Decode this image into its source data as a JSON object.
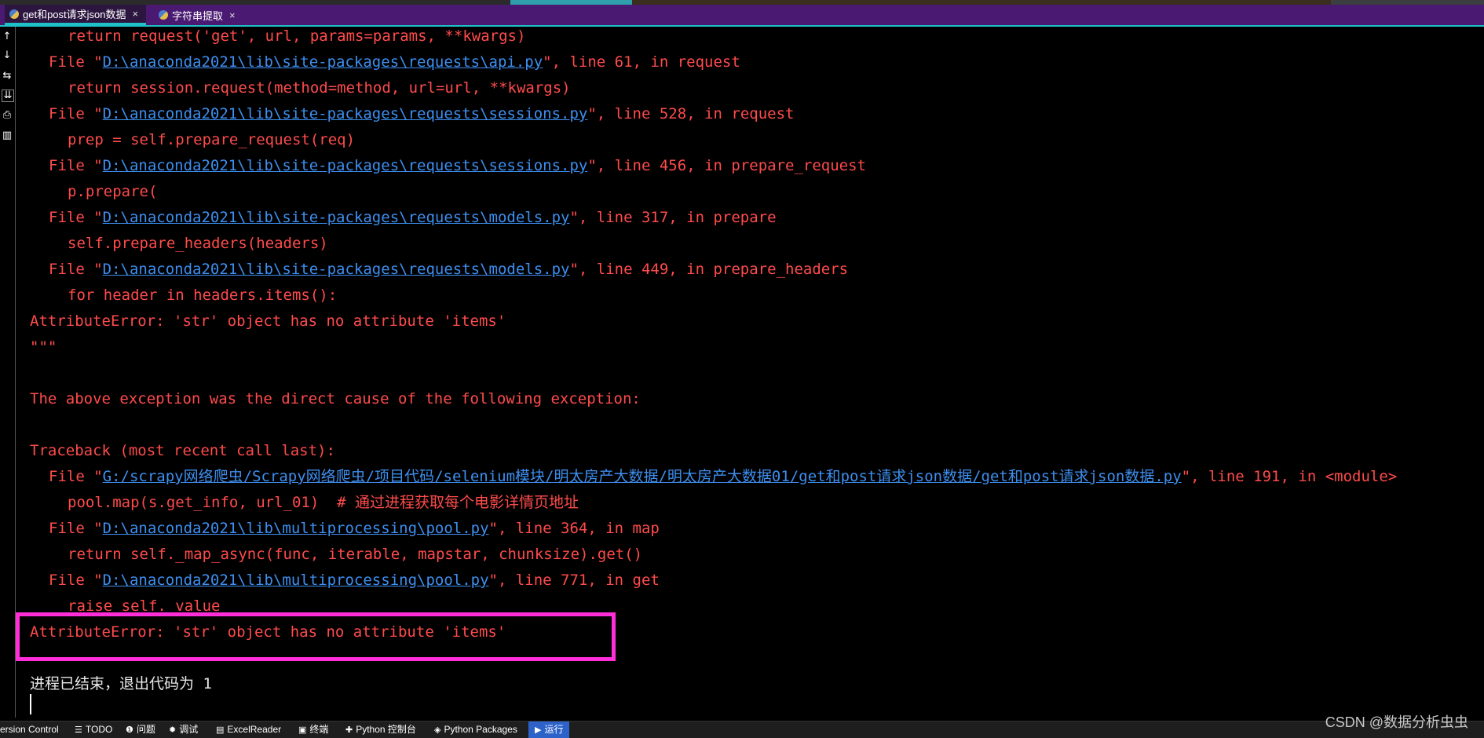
{
  "tabs": [
    {
      "label": "get和post请求json数据",
      "close": "×"
    },
    {
      "label": "字符串提取",
      "close": "×"
    }
  ],
  "gutter_icons": [
    "up-arrow-icon",
    "down-arrow-icon",
    "soft-wrap-icon",
    "scroll-to-end-icon",
    "print-icon",
    "trash-icon"
  ],
  "console": {
    "lines": [
      {
        "style": "red",
        "indent": 4,
        "text": "return request('get', url, params=params, **kwargs)"
      },
      {
        "style": "red",
        "indent": 2,
        "pre": "File \"",
        "link": "D:\\anaconda2021\\lib\\site-packages\\requests\\api.py",
        "post": "\", line 61, in request"
      },
      {
        "style": "red",
        "indent": 4,
        "text": "return session.request(method=method, url=url, **kwargs)"
      },
      {
        "style": "red",
        "indent": 2,
        "pre": "File \"",
        "link": "D:\\anaconda2021\\lib\\site-packages\\requests\\sessions.py",
        "post": "\", line 528, in request"
      },
      {
        "style": "red",
        "indent": 4,
        "text": "prep = self.prepare_request(req)"
      },
      {
        "style": "red",
        "indent": 2,
        "pre": "File \"",
        "link": "D:\\anaconda2021\\lib\\site-packages\\requests\\sessions.py",
        "post": "\", line 456, in prepare_request"
      },
      {
        "style": "red",
        "indent": 4,
        "text": "p.prepare("
      },
      {
        "style": "red",
        "indent": 2,
        "pre": "File \"",
        "link": "D:\\anaconda2021\\lib\\site-packages\\requests\\models.py",
        "post": "\", line 317, in prepare"
      },
      {
        "style": "red",
        "indent": 4,
        "text": "self.prepare_headers(headers)"
      },
      {
        "style": "red",
        "indent": 2,
        "pre": "File \"",
        "link": "D:\\anaconda2021\\lib\\site-packages\\requests\\models.py",
        "post": "\", line 449, in prepare_headers"
      },
      {
        "style": "red",
        "indent": 4,
        "text": "for header in headers.items():"
      },
      {
        "style": "red",
        "indent": 0,
        "text": "AttributeError: 'str' object has no attribute 'items'"
      },
      {
        "style": "red",
        "indent": 0,
        "text": "\"\"\""
      },
      {
        "style": "red",
        "indent": 0,
        "text": ""
      },
      {
        "style": "red",
        "indent": 0,
        "text": "The above exception was the direct cause of the following exception:"
      },
      {
        "style": "red",
        "indent": 0,
        "text": ""
      },
      {
        "style": "red",
        "indent": 0,
        "text": "Traceback (most recent call last):"
      },
      {
        "style": "red",
        "indent": 2,
        "pre": "File \"",
        "link": "G:/scrapy网络爬虫/Scrapy网络爬虫/项目代码/selenium模块/明太房产大数据/明太房产大数据01/get和post请求json数据/get和post请求json数据.py",
        "post": "\", line 191, in <module>"
      },
      {
        "style": "red",
        "indent": 4,
        "text": "pool.map(s.get_info, url_01)  # 通过进程获取每个电影详情页地址"
      },
      {
        "style": "red",
        "indent": 2,
        "pre": "File \"",
        "link": "D:\\anaconda2021\\lib\\multiprocessing\\pool.py",
        "post": "\", line 364, in map"
      },
      {
        "style": "red",
        "indent": 4,
        "text": "return self._map_async(func, iterable, mapstar, chunksize).get()"
      },
      {
        "style": "red",
        "indent": 2,
        "pre": "File \"",
        "link": "D:\\anaconda2021\\lib\\multiprocessing\\pool.py",
        "post": "\", line 771, in get"
      },
      {
        "style": "red",
        "indent": 4,
        "text": "raise self._value"
      },
      {
        "style": "red",
        "indent": 0,
        "text": "AttributeError: 'str' object has no attribute 'items'"
      },
      {
        "style": "red",
        "indent": 0,
        "text": ""
      },
      {
        "style": "white",
        "indent": 0,
        "text": "进程已结束，退出代码为 1"
      }
    ]
  },
  "bottom_toolbar": [
    {
      "label": "ersion Control",
      "icon": ""
    },
    {
      "label": "TODO",
      "icon": "☰"
    },
    {
      "label": "问题",
      "icon": "❶"
    },
    {
      "label": "调试",
      "icon": "✹"
    },
    {
      "label": "ExcelReader",
      "icon": "▤"
    },
    {
      "label": "终端",
      "icon": "▣"
    },
    {
      "label": "Python 控制台",
      "icon": "✚"
    },
    {
      "label": "Python Packages",
      "icon": "◈"
    },
    {
      "label": "运行",
      "icon": "▶"
    }
  ],
  "watermark": "CSDN @数据分析虫虫",
  "colors": {
    "error_text": "#ff4b4b",
    "link": "#3d8ff0",
    "tab_bar": "#4a1a72",
    "highlight_box": "#ff2ed8",
    "run_tab_active": "#2d62c9"
  }
}
